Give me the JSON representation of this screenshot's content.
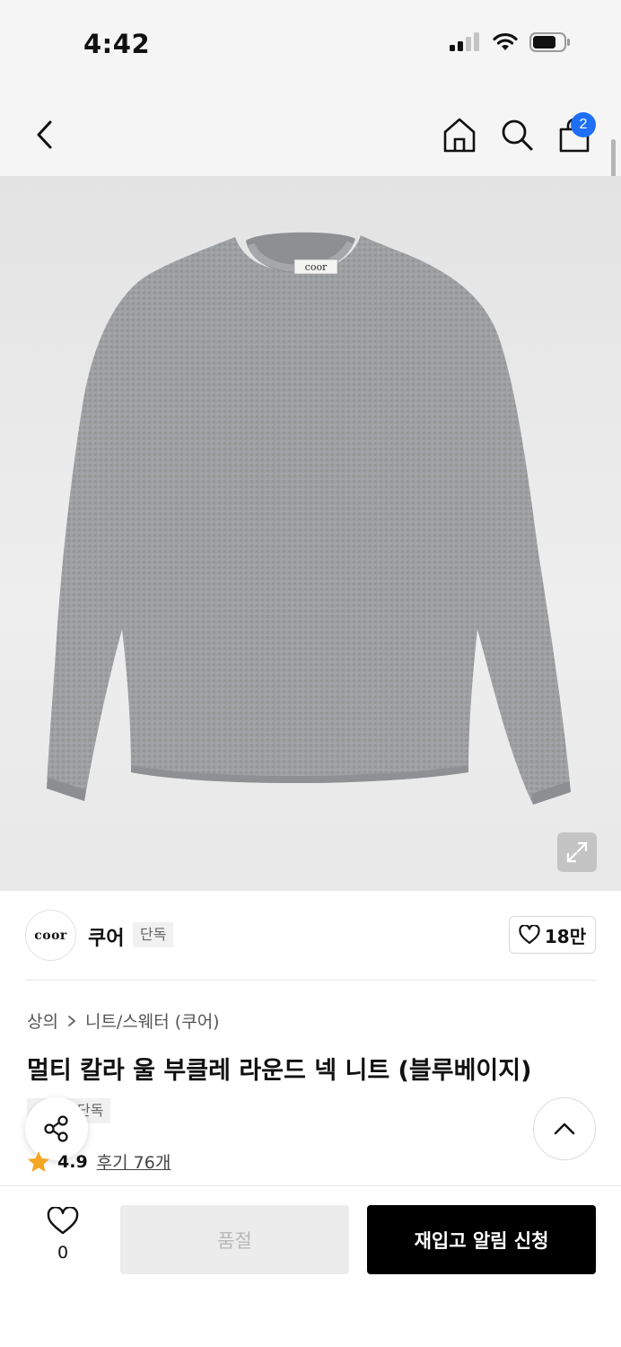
{
  "status_bar": {
    "time": "4:42",
    "icons": [
      "cellular-signal-icon",
      "wifi-icon",
      "battery-icon"
    ]
  },
  "nav": {
    "icons": [
      "back-arrow-icon",
      "home-icon",
      "search-icon",
      "shopping-bag-icon"
    ],
    "cart_count": "2"
  },
  "product_image": {
    "alt": "coor",
    "label_text": "coor"
  },
  "brand": {
    "logo_text": "coor",
    "name": "쿠어",
    "tag": "단독",
    "likes": "18만"
  },
  "breadcrumb": {
    "items": [
      "상의",
      "니트/스웨터 (쿠어)"
    ]
  },
  "product": {
    "title": "멀티 칼라 울 부클레 라운드 넥 니트 (블루베이지)",
    "exclusive_tag": "단독",
    "rating": "4.9",
    "reviews_label": "후기 76개"
  },
  "bottom_bar": {
    "wish_count": "0",
    "soldout_label": "품절",
    "restock_label": "재입고 알림 신청"
  },
  "colors": {
    "accent_blue": "#1f6ff6",
    "star": "#f5a623",
    "primary_button": "#000000",
    "disabled_button": "#ececec"
  }
}
